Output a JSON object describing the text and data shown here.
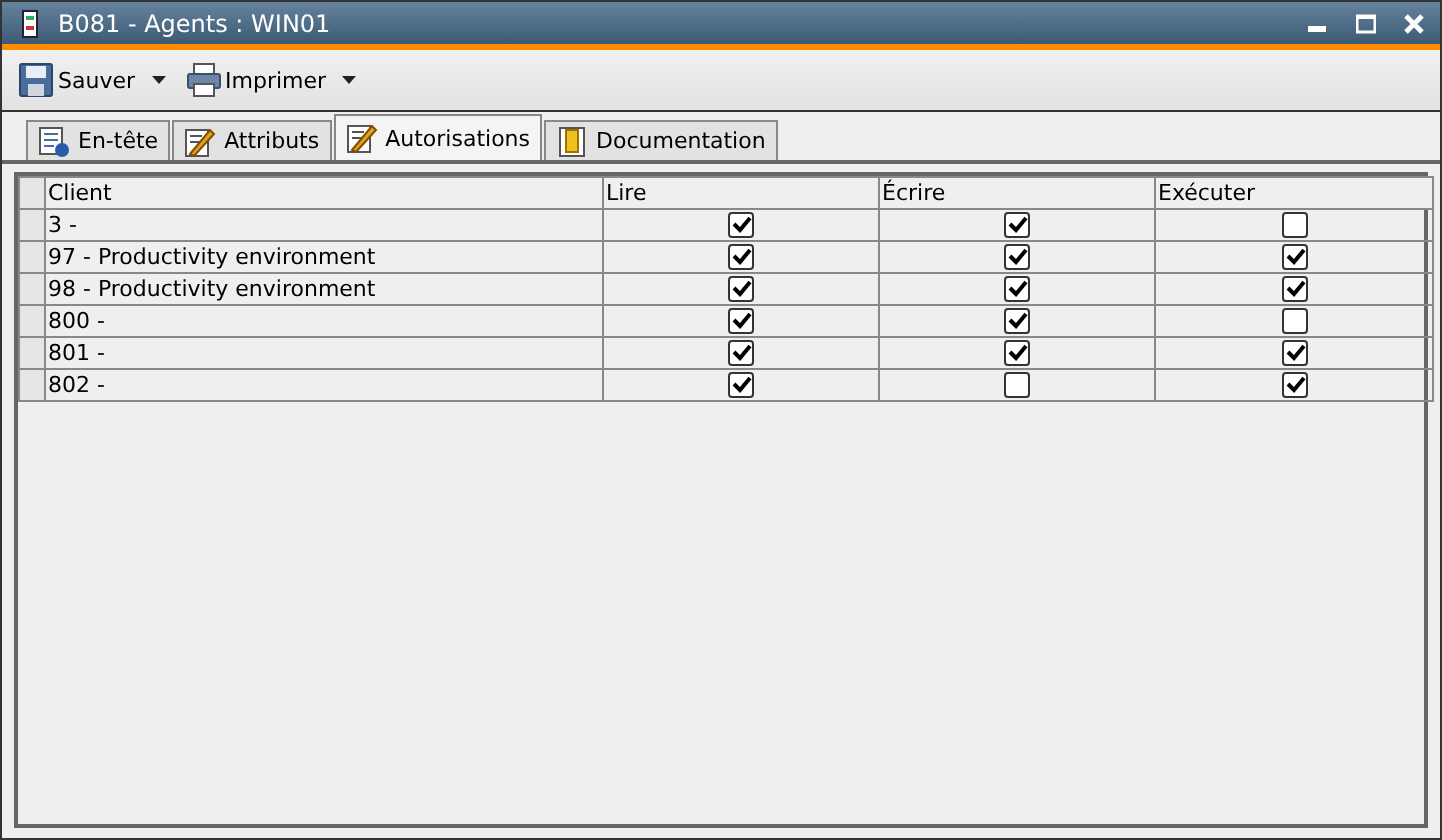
{
  "window": {
    "title": "B081 - Agents : WIN01"
  },
  "toolbar": [
    {
      "label": "Sauver",
      "kind": "save"
    },
    {
      "label": "Imprimer",
      "kind": "print"
    }
  ],
  "tabs": [
    {
      "label": "En-tête",
      "kind": "info",
      "selected": false
    },
    {
      "label": "Attributs",
      "kind": "edit",
      "selected": false
    },
    {
      "label": "Autorisations",
      "kind": "edit",
      "selected": true
    },
    {
      "label": "Documentation",
      "kind": "book",
      "selected": false
    }
  ],
  "table": {
    "columns": [
      "Client",
      "Lire",
      "Écrire",
      "Exécuter"
    ],
    "rows": [
      {
        "client": "3 -",
        "read": true,
        "write": true,
        "execute": false
      },
      {
        "client": "97 - Productivity environment",
        "read": true,
        "write": true,
        "execute": true
      },
      {
        "client": "98 - Productivity environment",
        "read": true,
        "write": true,
        "execute": true
      },
      {
        "client": "800 -",
        "read": true,
        "write": true,
        "execute": false
      },
      {
        "client": "801 -",
        "read": true,
        "write": true,
        "execute": true
      },
      {
        "client": "802 -",
        "read": true,
        "write": false,
        "execute": true
      }
    ]
  }
}
